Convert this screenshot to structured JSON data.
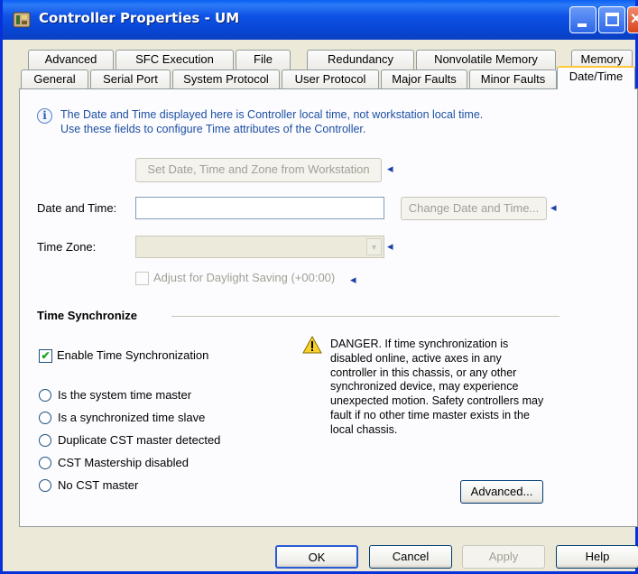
{
  "window": {
    "title": "Controller Properties - UM",
    "minimize_label": "_",
    "close_label": "✕"
  },
  "tabs": {
    "row1": [
      "Advanced",
      "SFC Execution",
      "File",
      "Redundancy",
      "Nonvolatile Memory",
      "Memory"
    ],
    "row2": [
      "General",
      "Serial Port",
      "System Protocol",
      "User Protocol",
      "Major Faults",
      "Minor Faults",
      "Date/Time"
    ],
    "active": "Date/Time"
  },
  "info": {
    "icon_glyph": "i",
    "line1": "The Date and Time displayed here is Controller local time, not workstation local time.",
    "line2": "Use these fields to configure Time attributes of the Controller."
  },
  "date_time": {
    "set_from_workstation_label": "Set Date, Time and Zone from Workstation",
    "date_time_label": "Date and Time:",
    "date_time_value": "",
    "change_button_label": "Change Date and Time...",
    "time_zone_label": "Time Zone:",
    "time_zone_value": "",
    "daylight_saving_label": "Adjust for Daylight Saving (+00:00)",
    "daylight_saving_checked": false,
    "arrow_glyph": "◂"
  },
  "time_sync": {
    "section_title": "Time Synchronize",
    "enable_label": "Enable Time Synchronization",
    "enable_checked": true,
    "check_glyph": "✔",
    "status_options": [
      "Is the system time master",
      "Is a synchronized time slave",
      "Duplicate CST master detected",
      "CST Mastership disabled",
      "No CST master"
    ],
    "warning_lines": [
      "DANGER. If time synchronization is",
      "disabled online, active axes in any",
      "controller in this chassis, or any other",
      "synchronized device, may experience",
      "unexpected motion.  Safety controllers may",
      "fault if no other time master exists in the",
      "local chassis."
    ],
    "advanced_button_label": "Advanced..."
  },
  "footer": {
    "ok_label": "OK",
    "cancel_label": "Cancel",
    "apply_label": "Apply",
    "help_label": "Help"
  },
  "colors": {
    "titlebar": "#0a46d4",
    "info_text": "#1d4fa3",
    "active_tab_accent": "#ffc83c",
    "dialog_bg": "#ece9d8"
  }
}
